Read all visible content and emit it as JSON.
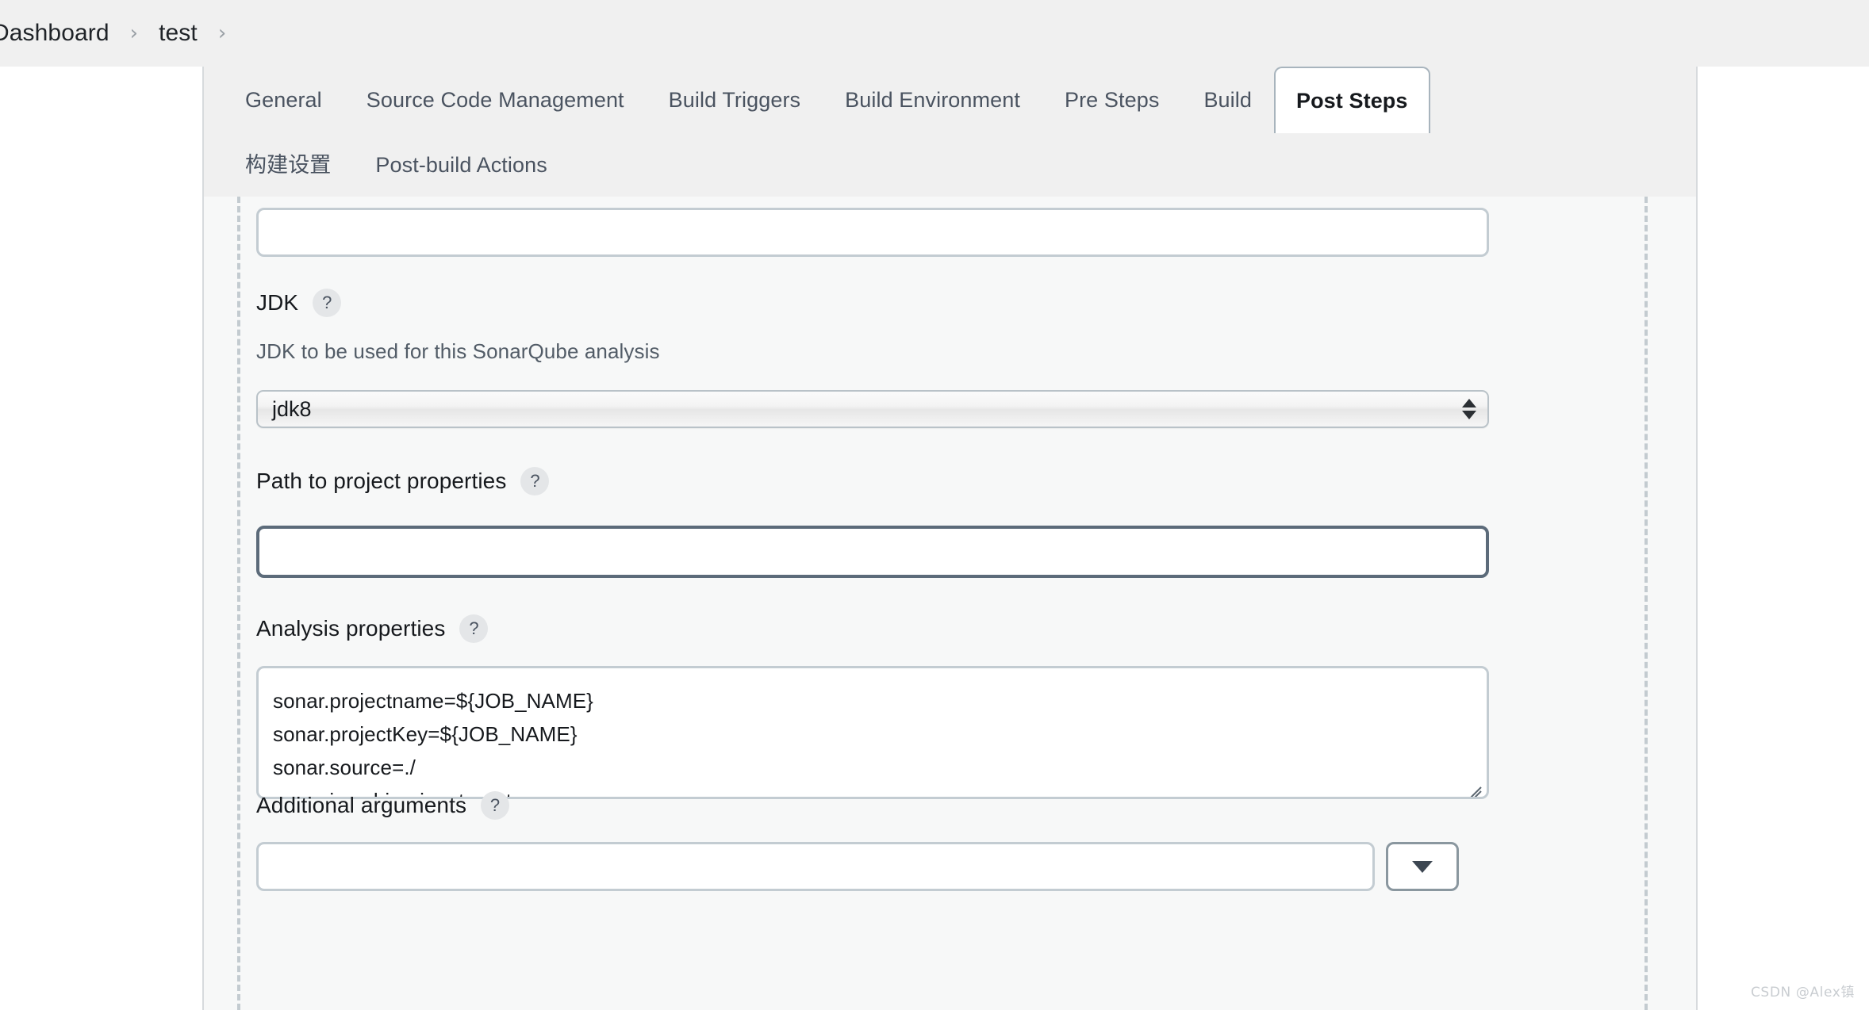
{
  "breadcrumb": {
    "items": [
      {
        "label": "Dashboard",
        "separator": "›"
      },
      {
        "label": "test",
        "separator": "›"
      }
    ]
  },
  "tabs": {
    "primary": [
      {
        "label": "General",
        "active": false
      },
      {
        "label": "Source Code Management",
        "active": false
      },
      {
        "label": "Build Triggers",
        "active": false
      },
      {
        "label": "Build Environment",
        "active": false
      },
      {
        "label": "Pre Steps",
        "active": false
      },
      {
        "label": "Build",
        "active": false
      },
      {
        "label": "Post Steps",
        "active": true
      }
    ],
    "secondary": [
      {
        "label": "构建设置",
        "active": false
      },
      {
        "label": "Post-build Actions",
        "active": false
      }
    ]
  },
  "form": {
    "top_input": {
      "name": "top-text-input",
      "value": "",
      "placeholder": ""
    },
    "jdk": {
      "label": "JDK",
      "help": "?",
      "description": "JDK to be used for this SonarQube analysis",
      "selected": "jdk8",
      "options": [
        "jdk8"
      ]
    },
    "path_to_project_properties": {
      "label": "Path to project properties",
      "help": "?",
      "value": "",
      "placeholder": "",
      "focused": true
    },
    "analysis_properties": {
      "label": "Analysis properties",
      "help": "?",
      "value": "sonar.projectname=${JOB_NAME}\nsonar.projectKey=${JOB_NAME}\nsonar.source=./\nsonar.java.binaries=target"
    },
    "additional_arguments": {
      "label": "Additional arguments",
      "help": "?",
      "value": "",
      "placeholder": "",
      "dropdown_icon": "caret-down-icon"
    }
  },
  "watermark": "CSDN @Alex镇",
  "colors": {
    "page_background": "#ffffff",
    "panel_background": "#f7f8f8",
    "tabbar_background": "#f0f0f0",
    "border": "#d7dadd",
    "input_border": "#c3ccd2",
    "focus_border": "#5c6b7a",
    "text": "#16191d",
    "muted_text": "#4a5360"
  }
}
